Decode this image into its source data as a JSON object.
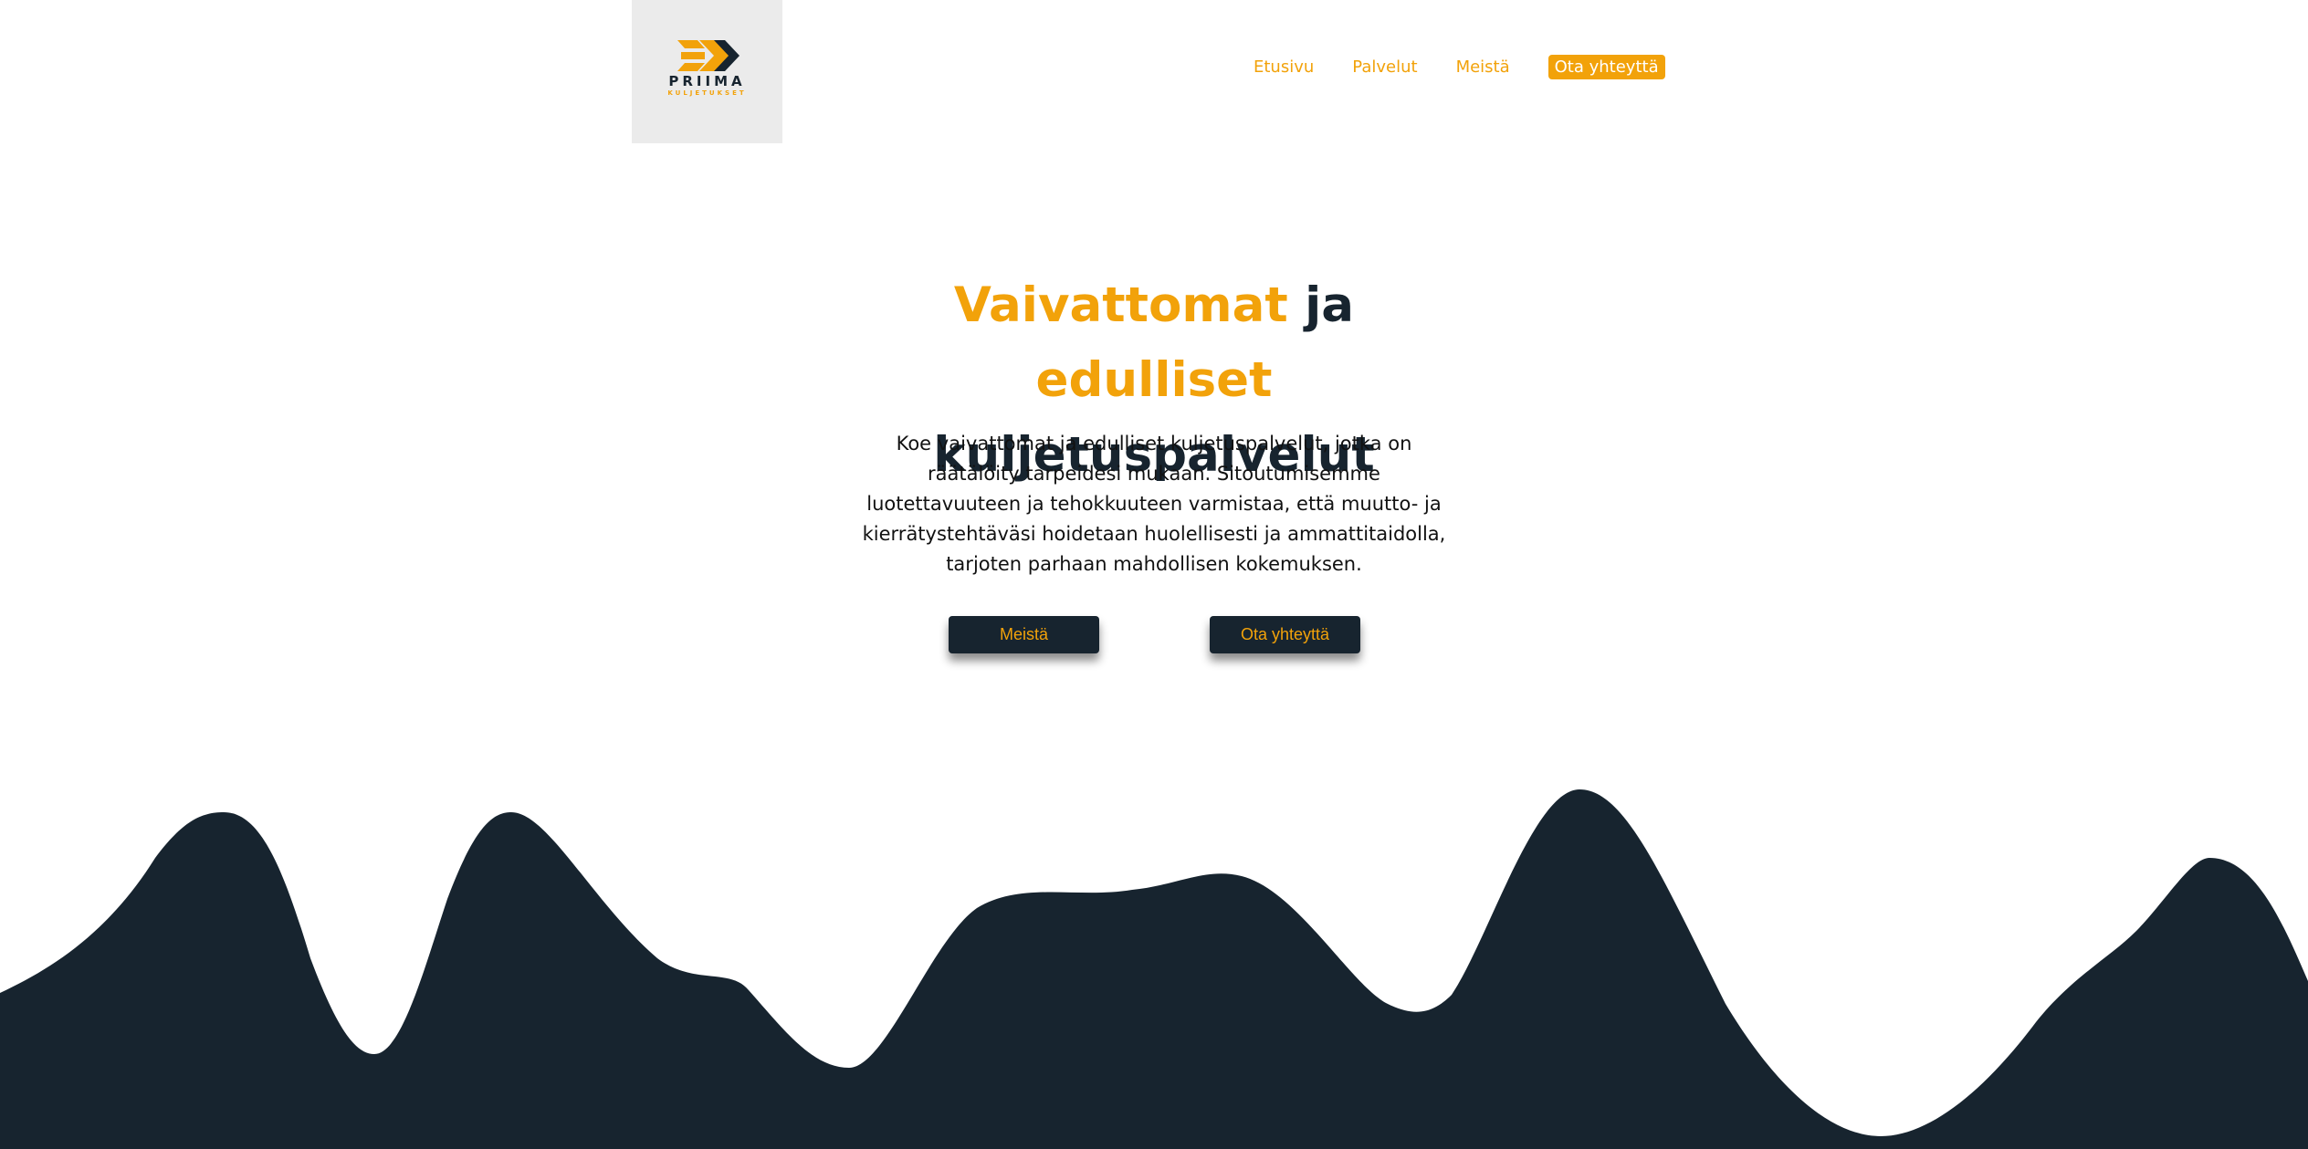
{
  "brand": {
    "name": "PRIIMA",
    "tagline": "KULJETUKSET",
    "colors": {
      "accent": "#f2a20a",
      "dark": "#17242f",
      "logo_background": "#ebebeb"
    }
  },
  "nav": {
    "items": [
      {
        "label": "Etusivu"
      },
      {
        "label": "Palvelut"
      },
      {
        "label": "Meistä"
      },
      {
        "label": "Ota yhteyttä"
      }
    ]
  },
  "hero": {
    "title": {
      "word1": "Vaivattomat",
      "word2": "ja",
      "word3": "edulliset",
      "line2": "kuljetuspalvelut"
    },
    "text": "Koe vaivattomat ja edulliset kuljetuspalvelut, jotka on räätälöity tarpeidesi mukaan. Sitoutumisemme luotettavuuteen ja tehokkuuteen varmistaa, että muutto- ja kierrätystehtäväsi hoidetaan huolellisesti ja ammattitaidolla, tarjoten parhaan mahdollisen kokemuksen.",
    "buttons": {
      "about": "Meistä",
      "contact": "Ota yhteyttä"
    }
  }
}
